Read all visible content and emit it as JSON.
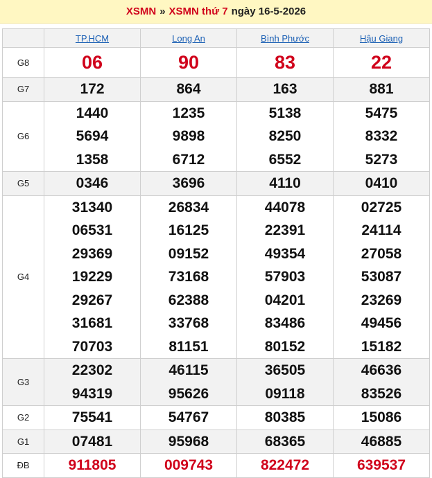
{
  "header": {
    "link1": "XSMN",
    "separator": "»",
    "link2": "XSMN thứ 7",
    "date_text": "ngày 16-5-2026"
  },
  "provinces": [
    "TP.HCM",
    "Long An",
    "Bình Phước",
    "Hậu Giang"
  ],
  "prizes": [
    {
      "label": "G8",
      "values": [
        [
          "06"
        ],
        [
          "90"
        ],
        [
          "83"
        ],
        [
          "22"
        ]
      ]
    },
    {
      "label": "G7",
      "values": [
        [
          "172"
        ],
        [
          "864"
        ],
        [
          "163"
        ],
        [
          "881"
        ]
      ]
    },
    {
      "label": "G6",
      "values": [
        [
          "1440",
          "5694",
          "1358"
        ],
        [
          "1235",
          "9898",
          "6712"
        ],
        [
          "5138",
          "8250",
          "6552"
        ],
        [
          "5475",
          "8332",
          "5273"
        ]
      ]
    },
    {
      "label": "G5",
      "values": [
        [
          "0346"
        ],
        [
          "3696"
        ],
        [
          "4110"
        ],
        [
          "0410"
        ]
      ]
    },
    {
      "label": "G4",
      "values": [
        [
          "31340",
          "06531",
          "29369",
          "19229",
          "29267",
          "31681",
          "70703"
        ],
        [
          "26834",
          "16125",
          "09152",
          "73168",
          "62388",
          "33768",
          "81151"
        ],
        [
          "44078",
          "22391",
          "49354",
          "57903",
          "04201",
          "83486",
          "80152"
        ],
        [
          "02725",
          "24114",
          "27058",
          "53087",
          "23269",
          "49456",
          "15182"
        ]
      ]
    },
    {
      "label": "G3",
      "values": [
        [
          "22302",
          "94319"
        ],
        [
          "46115",
          "95626"
        ],
        [
          "36505",
          "09118"
        ],
        [
          "46636",
          "83526"
        ]
      ]
    },
    {
      "label": "G2",
      "values": [
        [
          "75541"
        ],
        [
          "54767"
        ],
        [
          "80385"
        ],
        [
          "15086"
        ]
      ]
    },
    {
      "label": "G1",
      "values": [
        [
          "07481"
        ],
        [
          "95968"
        ],
        [
          "68365"
        ],
        [
          "46885"
        ]
      ]
    },
    {
      "label": "ĐB",
      "values": [
        [
          "911805"
        ],
        [
          "009743"
        ],
        [
          "822472"
        ],
        [
          "639537"
        ]
      ]
    }
  ],
  "colors": {
    "accent_red": "#d0021b",
    "link_blue": "#1a5fb4",
    "header_bg": "#fff7c2",
    "alt_row": "#f2f2f2"
  }
}
